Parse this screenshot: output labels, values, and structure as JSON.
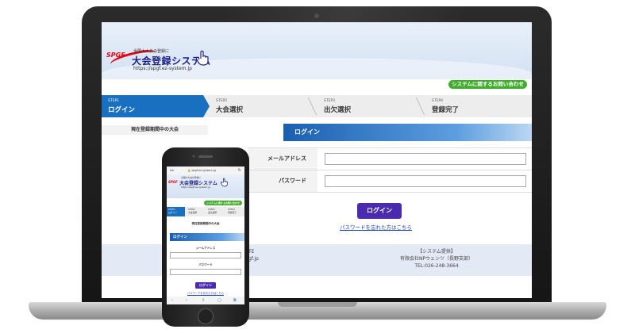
{
  "desktop": {
    "brand_mark": "SPGF",
    "tagline": "全国大大会の登録に",
    "logo_text": "大会登録システム",
    "site_url": "https://spgf.ez-system.jp",
    "contact_button": "システムに関するお問い合わせ",
    "steps": [
      {
        "num": "STEP1",
        "label": "ログイン"
      },
      {
        "num": "STEP2",
        "label": "大会選択"
      },
      {
        "num": "STEP3",
        "label": "出欠選択"
      },
      {
        "num": "STEP4",
        "label": "登録完了"
      }
    ],
    "sidebar_title": "現在登録期間中の大会",
    "login_heading": "ログイン",
    "email_label": "メールアドレス",
    "password_label": "パスワード",
    "login_button": "ログイン",
    "forgot_link": "パスワードを忘れた方はこちら",
    "footer_left": [
      "TE",
      "gf.jp"
    ],
    "footer_right": [
      "【システム提供】",
      "有限会社NPウェンツ（長野支部）",
      "TEL:026-248-3664"
    ]
  },
  "phone": {
    "status_aa": "AA",
    "status_url": "🔒 spgf.ez-system.jp",
    "status_reload": "↻",
    "brand_mark": "SPGF",
    "tagline": "全国大大会の登録に",
    "logo_text": "大会登録システム",
    "site_url": "https://spgf.ez-system.jp",
    "contact_button": "システムに関するお問い合わせ",
    "steps": [
      {
        "num": "STEP1",
        "label": "ログイン"
      },
      {
        "num": "STEP2",
        "label": "大会選択"
      },
      {
        "num": "STEP3",
        "label": "出欠選択"
      },
      {
        "num": "STEP4",
        "label": "登録完了"
      }
    ],
    "sidebar_title": "現在登録期間中の大会",
    "login_heading": "ログイン",
    "email_label": "メールアドレス",
    "password_label": "パスワード",
    "login_button": "ログイン",
    "forgot_link": "パスワードを忘れた方はこちら",
    "nav": [
      "‹",
      "›",
      "⇧",
      "▢",
      "⧉"
    ]
  },
  "colors": {
    "accent_blue": "#1a70c0",
    "button_purple": "#4a2bb0",
    "contact_green": "#3fae2a",
    "brand_red": "#e60012",
    "logo_navy": "#1d2088"
  }
}
